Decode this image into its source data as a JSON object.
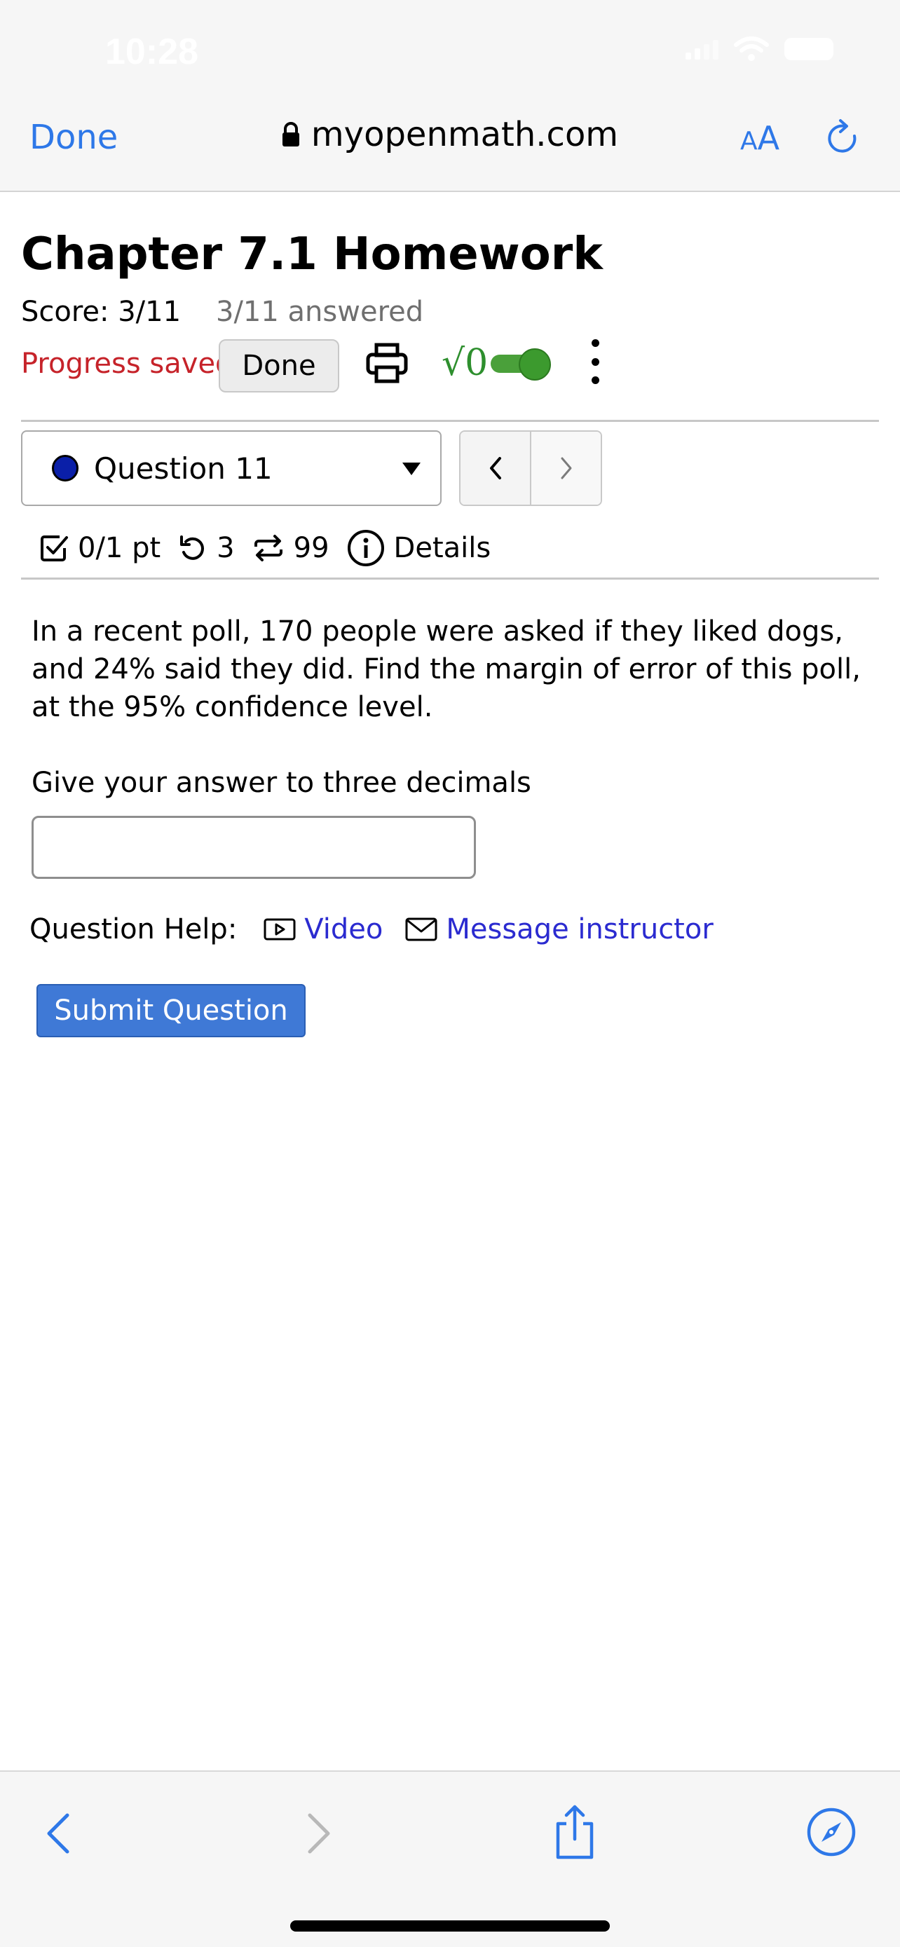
{
  "status_bar": {
    "time": "10:28"
  },
  "browser": {
    "done_label": "Done",
    "url": "myopenmath.com",
    "reader_small": "A",
    "reader_large": "A"
  },
  "assignment": {
    "title": "Chapter 7.1 Homework",
    "score": "Score: 3/11",
    "answered": "3/11 answered",
    "progress": "Progress saved",
    "done_button": "Done",
    "math_toggle_label": "√0",
    "math_toggle_on": true
  },
  "question_nav": {
    "selected": "Question 11",
    "status_color": "#0a1fa8"
  },
  "question_meta": {
    "points": "0/1 pt",
    "retries": "3",
    "attempts": "99",
    "details_label": "Details"
  },
  "question": {
    "text": "In a recent poll, 170 people were asked if they liked dogs, and 24% said they did. Find the margin of error of this poll, at the 95% confidence level.",
    "prompt": "Give your answer to three decimals",
    "answer_value": "",
    "help_label": "Question Help:",
    "video_label": "Video",
    "message_label": "Message instructor",
    "submit_label": "Submit Question"
  },
  "colors": {
    "accent": "#2e78e8",
    "progress_red": "#c6232a",
    "toggle_green": "#3c9a2e",
    "submit_blue": "#3f79d6",
    "link_blue": "#2b2bd0"
  }
}
